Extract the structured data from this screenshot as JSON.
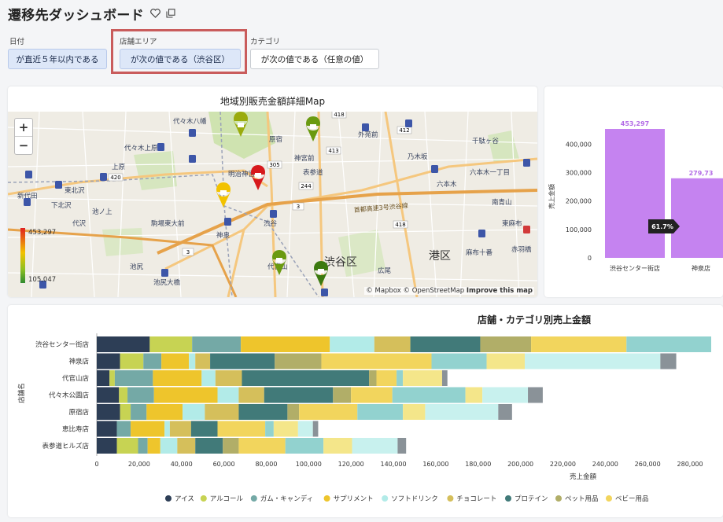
{
  "header": {
    "title": "遷移先ダッシュボード",
    "favorite_icon": "heart-icon",
    "duplicate_icon": "copy-icon"
  },
  "filters": [
    {
      "label": "日付",
      "value": "が直近５年以内である",
      "style": "blue"
    },
    {
      "label": "店舗エリア",
      "value": "が次の値である（渋谷区）",
      "style": "blue",
      "highlighted": true
    },
    {
      "label": "カテゴリ",
      "value": "が次の値である（任意の値）",
      "style": "white"
    }
  ],
  "map": {
    "title": "地域別販売金額詳細Map",
    "legend_max": "453,297",
    "legend_min": "105,047",
    "attribution": {
      "mapbox": "© Mapbox",
      "osm": "© OpenStreetMap",
      "improve": "Improve this map"
    },
    "labels": [
      "代々木八幡",
      "代々木上原",
      "上原",
      "新代田",
      "東北沢",
      "下北沢",
      "池ノ上",
      "代沢",
      "駒場東大前",
      "池尻",
      "池尻大橋",
      "神泉",
      "渋谷",
      "渋谷区",
      "港区",
      "原宿",
      "神宮前",
      "明治神宮前",
      "外苑前",
      "乃木坂",
      "六本木一丁目",
      "六本木",
      "表参道",
      "代官山",
      "広尾",
      "麻布十番",
      "赤羽橋",
      "東麻布",
      "首都高速3号渋谷線",
      "千駄ヶ谷",
      "南青山"
    ],
    "roads": [
      "418",
      "413",
      "420",
      "305",
      "244",
      "3",
      "3",
      "418",
      "412"
    ],
    "pin_colors": {
      "red": "#d7191c",
      "yellow": "#f2c200",
      "olive": "#9aab0c",
      "lime": "#6a9a10",
      "green": "#3c7a10"
    }
  },
  "bar_chart": {
    "ylabel": "売上金額",
    "yticks": [
      "400,000",
      "300,000",
      "200,000",
      "100,000",
      "0"
    ],
    "ylim": [
      0,
      453297
    ],
    "bars": [
      {
        "store": "渋谷センター街店",
        "value": 453297,
        "label": "453,297"
      },
      {
        "store": "神泉店",
        "value": 279738,
        "label": "279,73"
      }
    ],
    "ratio_badge": "61.7%",
    "color": "#c583f0"
  },
  "chart_data": {
    "type": "bar",
    "orientation": "horizontal",
    "stacked": true,
    "title": "店舗・カテゴリ別売上金額",
    "xlabel": "売上金額",
    "ylabel": "店舗名",
    "xlim": [
      0,
      290000
    ],
    "xticks": [
      "0",
      "20,000",
      "40,000",
      "60,000",
      "80,000",
      "100,000",
      "120,000",
      "140,000",
      "160,000",
      "180,000",
      "200,000",
      "220,000",
      "240,000",
      "260,000",
      "280,000"
    ],
    "categories": [
      "渋谷センター街店",
      "神泉店",
      "代官山店",
      "代々木公園店",
      "原宿店",
      "恵比寿店",
      "表参道ヒルズ店"
    ],
    "legend_position": "bottom",
    "series": [
      {
        "name": "アイス",
        "color": "#2d3e56",
        "values": [
          25000,
          11000,
          6000,
          10500,
          11000,
          9500,
          9500
        ]
      },
      {
        "name": "アルコール",
        "color": "#c7d353",
        "values": [
          20000,
          11000,
          2500,
          4000,
          5000,
          0,
          10000
        ]
      },
      {
        "name": "ガム・キャンディ",
        "color": "#74a9a6",
        "values": [
          23000,
          8500,
          18000,
          12500,
          7500,
          6500,
          4500
        ]
      },
      {
        "name": "サプリメント",
        "color": "#eec52c",
        "values": [
          42000,
          13000,
          23000,
          30000,
          17000,
          16000,
          6000
        ]
      },
      {
        "name": "ソフトドリンク",
        "color": "#b2ebe8",
        "values": [
          21000,
          3000,
          6500,
          10000,
          10500,
          2500,
          8000
        ]
      },
      {
        "name": "チョコレート",
        "color": "#d5bf5b",
        "values": [
          17000,
          7000,
          12500,
          12000,
          16000,
          10000,
          8500
        ]
      },
      {
        "name": "プロテイン",
        "color": "#417a79",
        "values": [
          33000,
          30500,
          60000,
          32500,
          23000,
          12500,
          13000
        ]
      },
      {
        "name": "ペット用品",
        "color": "#b1ae68",
        "values": [
          24000,
          22000,
          3500,
          8500,
          5500,
          0,
          7500
        ]
      },
      {
        "name": "ベビー用品",
        "color": "#f2d55d",
        "values": [
          45000,
          52000,
          9500,
          19500,
          27500,
          22500,
          22000
        ]
      },
      {
        "name": "",
        "color": "#92d2cf",
        "values": [
          40000,
          26000,
          3000,
          34500,
          21500,
          4000,
          18000
        ]
      },
      {
        "name": "",
        "color": "#f4e68a",
        "values": [
          0,
          18000,
          18500,
          8000,
          10500,
          11500,
          13500
        ]
      },
      {
        "name": "",
        "color": "#c8f1ee",
        "values": [
          0,
          64000,
          0,
          21500,
          34500,
          7000,
          21500
        ]
      },
      {
        "name": "",
        "color": "#8a9298",
        "values": [
          0,
          7500,
          2500,
          7000,
          6500,
          2500,
          4000
        ]
      }
    ]
  }
}
